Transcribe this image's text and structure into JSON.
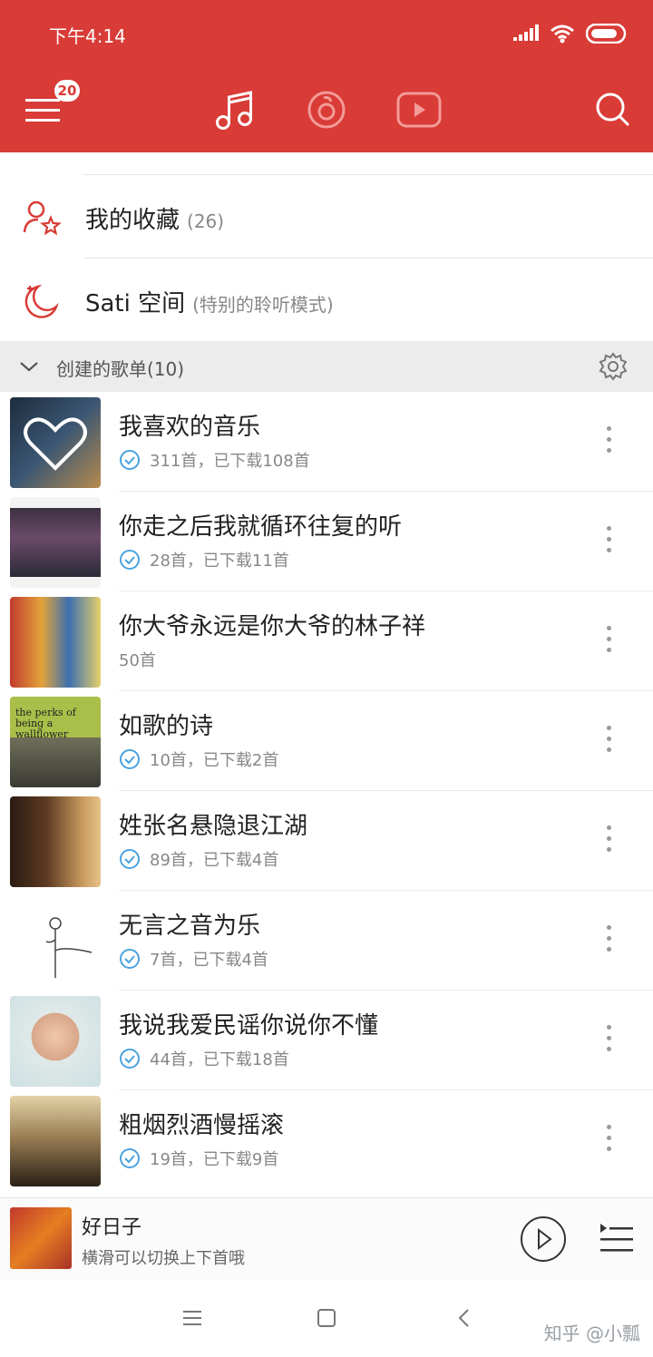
{
  "status_bar": {
    "time": "下午4:14"
  },
  "header": {
    "menu_badge": "20",
    "tabs": [
      "music-note-icon",
      "radio-icon",
      "video-icon"
    ],
    "colors": {
      "accent": "#d93b36"
    }
  },
  "quick_items": [
    {
      "label": "我的收藏",
      "sub": "(26)",
      "icon": "user-star-icon"
    },
    {
      "label": "Sati 空间",
      "sub": "(特别的聆听模式)",
      "icon": "moon-icon"
    }
  ],
  "section": {
    "title": "创建的歌单(10)"
  },
  "playlists": [
    {
      "name": "我喜欢的音乐",
      "meta": "311首，已下载108首",
      "downloaded": true
    },
    {
      "name": "你走之后我就循环往复的听",
      "meta": "28首，已下载11首",
      "downloaded": true
    },
    {
      "name": "你大爷永远是你大爷的林子祥",
      "meta": "50首",
      "downloaded": false
    },
    {
      "name": "如歌的诗",
      "meta": "10首，已下载2首",
      "downloaded": true
    },
    {
      "name": "姓张名悬隐退江湖",
      "meta": "89首，已下载4首",
      "downloaded": true
    },
    {
      "name": "无言之音为乐",
      "meta": "7首，已下载4首",
      "downloaded": true
    },
    {
      "name": "我说我爱民谣你说你不懂",
      "meta": "44首，已下载18首",
      "downloaded": true
    },
    {
      "name": "粗烟烈酒慢摇滚",
      "meta": "19首，已下载9首",
      "downloaded": true
    }
  ],
  "cover_texts": {
    "perks": "the perks of being a wallflower"
  },
  "player": {
    "song": "好日子",
    "hint": "横滑可以切换上下首哦"
  },
  "watermark": "知乎 @小瓢"
}
